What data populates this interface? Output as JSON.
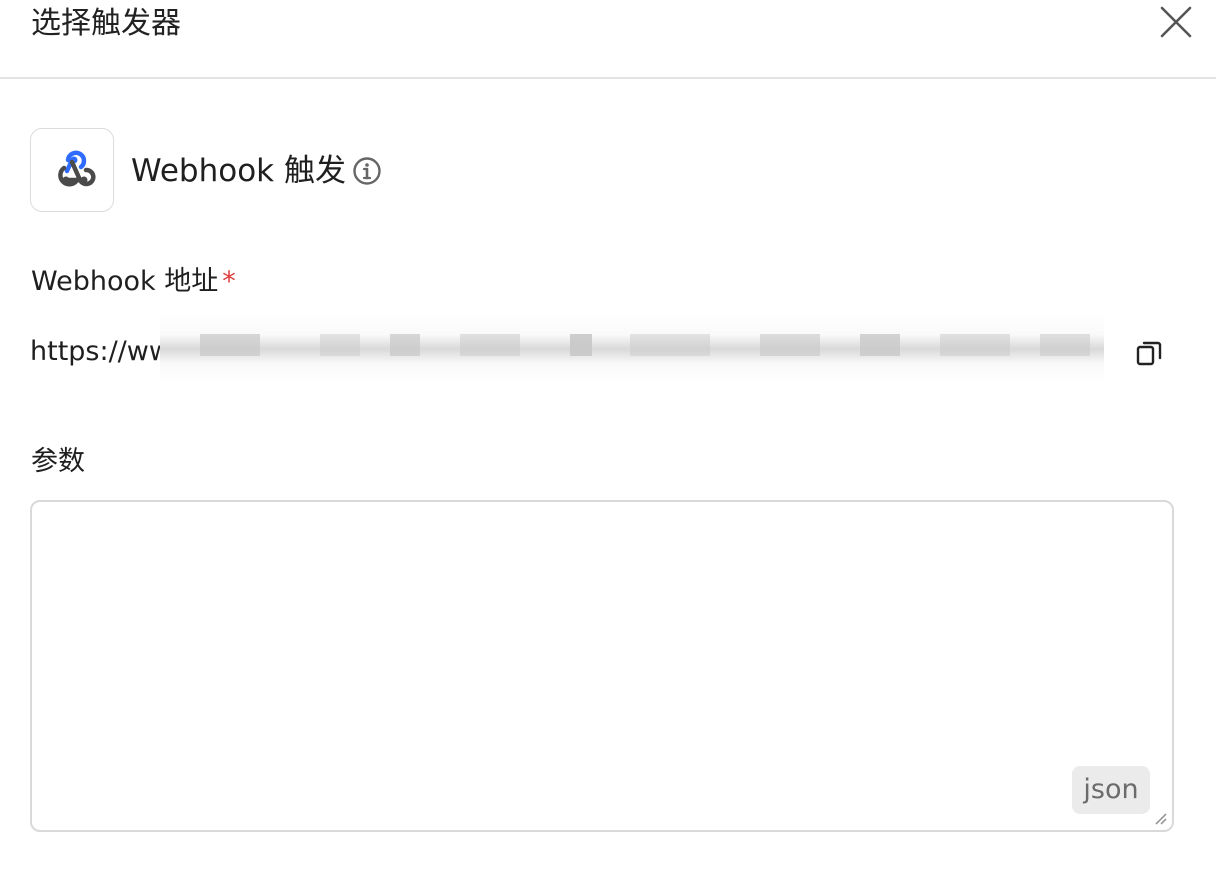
{
  "dialog": {
    "title": "选择触发器",
    "close_icon": "close-icon"
  },
  "trigger": {
    "icon": "webhook-icon",
    "name": "Webhook 触发",
    "info_icon": "info-icon"
  },
  "webhook_url": {
    "label": "Webhook 地址",
    "required_mark": "*",
    "value_prefix": "https://ww",
    "copy_icon": "copy-icon"
  },
  "params": {
    "label": "参数",
    "value": "",
    "format_tag": "json"
  },
  "colors": {
    "required": "#e03a3a",
    "webhook_blue": "#2f6bff",
    "border": "#d9d9d9"
  }
}
